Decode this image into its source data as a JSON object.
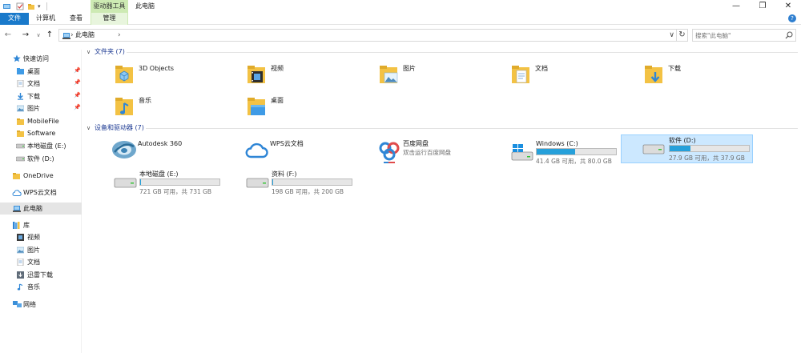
{
  "window": {
    "contextual_group": "驱动器工具",
    "title": "此电脑",
    "minimize": "—",
    "maximize": "❐",
    "close": "✕"
  },
  "ribbon": {
    "tabs": [
      "文件",
      "计算机",
      "查看",
      "管理"
    ],
    "help": "?"
  },
  "address": {
    "back": "←",
    "forward": "→",
    "recent": "∨",
    "up": "↑",
    "location": "此电脑",
    "separator": "›",
    "dropdown": "∨",
    "refresh": "↻",
    "search_placeholder": "搜索\"此电脑\""
  },
  "nav_pane": {
    "items": [
      {
        "label": "快速访问",
        "icon": "star-icon",
        "pinned": false
      },
      {
        "label": "桌面",
        "icon": "desktop-folder-icon",
        "pinned": true
      },
      {
        "label": "文档",
        "icon": "documents-folder-icon",
        "pinned": true
      },
      {
        "label": "下载",
        "icon": "downloads-folder-icon",
        "pinned": true
      },
      {
        "label": "图片",
        "icon": "pictures-folder-icon",
        "pinned": true
      },
      {
        "label": "MobileFile",
        "icon": "folder-icon",
        "pinned": false
      },
      {
        "label": "Software",
        "icon": "folder-icon",
        "pinned": false
      },
      {
        "label": "本地磁盘 (E:)",
        "icon": "drive-icon",
        "pinned": false
      },
      {
        "label": "软件 (D:)",
        "icon": "drive-icon",
        "pinned": false
      },
      {
        "label": "OneDrive",
        "icon": "onedrive-icon",
        "pinned": false
      },
      {
        "label": "WPS云文档",
        "icon": "cloud-icon",
        "pinned": false
      },
      {
        "label": "此电脑",
        "icon": "computer-icon",
        "pinned": false,
        "selected": true
      },
      {
        "label": "库",
        "icon": "library-icon",
        "pinned": false
      },
      {
        "label": "视频",
        "icon": "videos-library-icon",
        "pinned": false
      },
      {
        "label": "图片",
        "icon": "pictures-library-icon",
        "pinned": false
      },
      {
        "label": "文档",
        "icon": "documents-library-icon",
        "pinned": false
      },
      {
        "label": "迅雷下载",
        "icon": "download-library-icon",
        "pinned": false
      },
      {
        "label": "音乐",
        "icon": "music-library-icon",
        "pinned": false
      },
      {
        "label": "网络",
        "icon": "network-icon",
        "pinned": false
      }
    ]
  },
  "folders_group": {
    "title": "文件夹 (7)",
    "items": [
      {
        "label": "3D Objects",
        "icon": "3d-objects-folder-icon"
      },
      {
        "label": "视频",
        "icon": "videos-folder-icon"
      },
      {
        "label": "图片",
        "icon": "pictures-folder-icon"
      },
      {
        "label": "文档",
        "icon": "documents-folder-icon"
      },
      {
        "label": "下载",
        "icon": "downloads-folder-icon"
      },
      {
        "label": "音乐",
        "icon": "music-folder-icon"
      },
      {
        "label": "桌面",
        "icon": "desktop-folder-icon"
      }
    ]
  },
  "devices_group": {
    "title": "设备和驱动器 (7)",
    "items": [
      {
        "label": "Autodesk 360",
        "icon": "autodesk-360-icon"
      },
      {
        "label": "WPS云文档",
        "icon": "wps-cloud-icon"
      },
      {
        "label": "百度网盘",
        "sub": "双击运行百度网盘",
        "icon": "baidu-netdisk-icon"
      },
      {
        "label": "Windows (C:)",
        "sub": "41.4 GB 可用，共 80.0 GB",
        "used_fraction": 0.48,
        "icon": "windows-drive-icon"
      },
      {
        "label": "软件 (D:)",
        "sub": "27.9 GB 可用，共 37.9 GB",
        "used_fraction": 0.26,
        "icon": "drive-icon",
        "selected": true
      },
      {
        "label": "本地磁盘 (E:)",
        "sub": "721 GB 可用，共 731 GB",
        "used_fraction": 0.014,
        "icon": "drive-icon"
      },
      {
        "label": "资料 (F:)",
        "sub": "198 GB 可用，共 200 GB",
        "used_fraction": 0.01,
        "icon": "drive-icon"
      }
    ]
  },
  "colors": {
    "accent": "#1979ca",
    "group_title": "#1e3b93",
    "selection": "#cce8ff",
    "bar_fill": "#26a0da",
    "contextual_tab": "#cdeab3"
  }
}
